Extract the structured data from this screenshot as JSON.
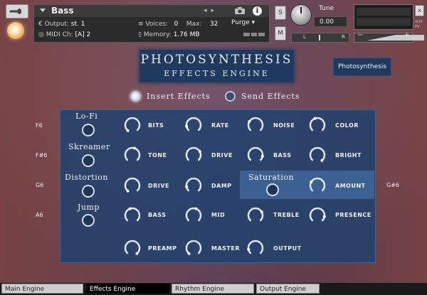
{
  "header": {
    "instrument_name": "Bass",
    "output_label": "Output:",
    "output_value": "st. 1",
    "midi_label": "MIDI Ch:",
    "midi_value": "[A]  2",
    "voices_label": "Voices:",
    "voices_value": "0",
    "max_label": "Max:",
    "max_value": "32",
    "memory_label": "Memory:",
    "memory_value": "1.76 MB",
    "purge_label": "Purge",
    "solo_label": "S",
    "mute_label": "M",
    "tune_label": "Tune",
    "tune_value": "0.00",
    "pan_left": "L",
    "pan_right": "R",
    "vol_minus": "−",
    "vol_plus": "+",
    "close_label": "x",
    "aux_label": "AUX",
    "pv_label": "PV"
  },
  "title": {
    "main": "PHOTOSYNTHESIS",
    "sub": "EFFECTS ENGINE"
  },
  "preset": "Photosynthesis",
  "modes": [
    {
      "label": "Insert Effects",
      "active": true
    },
    {
      "label": "Send Effects",
      "active": false
    }
  ],
  "effects": [
    {
      "note": "F6",
      "name": "Lo-Fi",
      "params": [
        "BITS",
        "RATE",
        "NOISE",
        "COLOR"
      ]
    },
    {
      "note": "F#6",
      "name": "Skreamer",
      "params": [
        "TONE",
        "DRIVE",
        "BASS",
        "BRIGHT"
      ]
    },
    {
      "note": "G6",
      "name": "Distortion",
      "params": [
        "DRIVE",
        "DAMP"
      ]
    },
    {
      "note": "A6",
      "name": "Jump",
      "params": [
        "BASS",
        "MID",
        "TREBLE",
        "PRESENCE"
      ]
    }
  ],
  "saturation": {
    "note": "G#6",
    "name": "Saturation",
    "param": "AMOUNT"
  },
  "master_row": [
    "PREAMP",
    "MASTER",
    "OUTPUT"
  ],
  "tabs": [
    {
      "label": "Main Engine",
      "active": false
    },
    {
      "label": "Effects Engine",
      "active": true
    },
    {
      "label": "Rhythm Engine",
      "active": false
    },
    {
      "label": "Output Engine",
      "active": false
    }
  ],
  "colors": {
    "panel": "#21426e",
    "title_bg": "#1f3a5e",
    "knob_ring": "#dfe6ef"
  },
  "icons": [
    "wrench-icon",
    "avatar-icon",
    "camera-icon",
    "info-icon",
    "chevron-left-icon",
    "chevron-right-icon"
  ]
}
